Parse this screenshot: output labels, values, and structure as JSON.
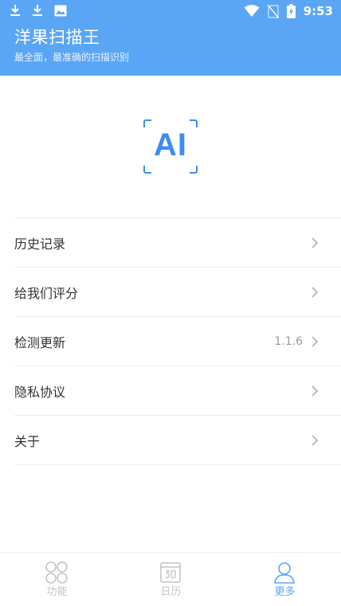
{
  "status_bar": {
    "time": "9:53",
    "left_icons": [
      "download-icon",
      "download-icon",
      "image-icon"
    ],
    "right_icons": [
      "wifi-icon",
      "no-sim-icon",
      "battery-charging-icon"
    ]
  },
  "header": {
    "title": "洋果扫描王",
    "subtitle": "最全面，最准确的扫描识别"
  },
  "logo": {
    "text": "AI"
  },
  "menu": {
    "items": [
      {
        "label": "历史记录",
        "value": ""
      },
      {
        "label": "给我们评分",
        "value": ""
      },
      {
        "label": "检测更新",
        "value": "1.1.6"
      },
      {
        "label": "隐私协议",
        "value": ""
      },
      {
        "label": "关于",
        "value": ""
      }
    ]
  },
  "bottom_nav": {
    "items": [
      {
        "label": "功能",
        "icon": "grid-icon",
        "active": false
      },
      {
        "label": "日历",
        "icon": "calendar-icon",
        "active": false
      },
      {
        "label": "更多",
        "icon": "user-icon",
        "active": true
      }
    ]
  },
  "colors": {
    "primary": "#5aa6f5",
    "logo": "#3d8df2",
    "inactive": "#c4c4c4"
  }
}
